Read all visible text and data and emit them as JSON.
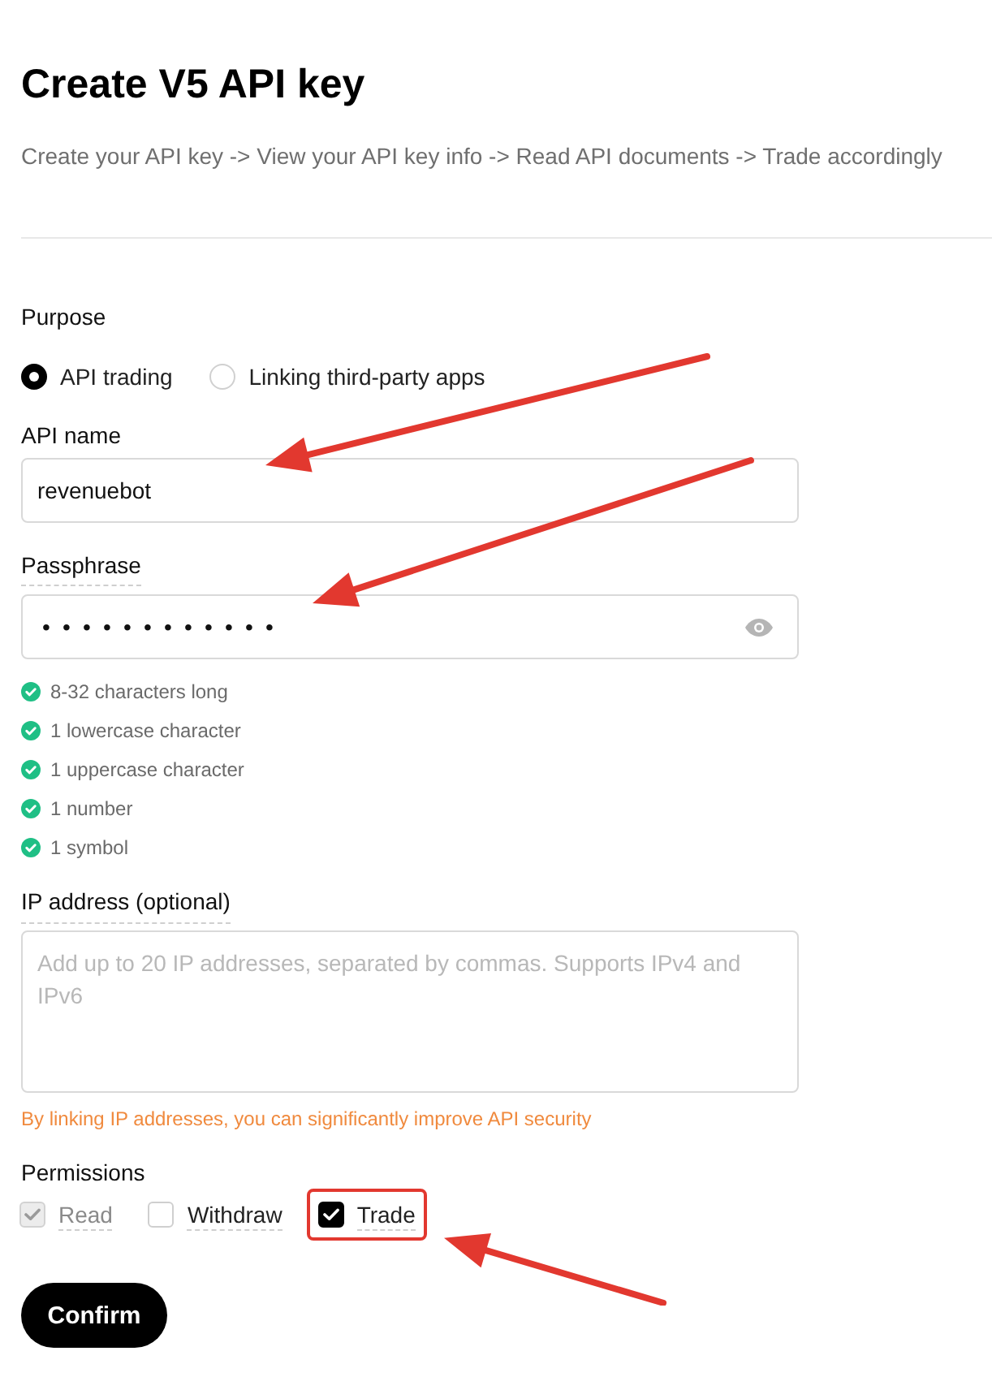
{
  "title": "Create V5 API key",
  "subtitle": "Create your API key -> View your API key info -> Read API documents -> Trade accordingly",
  "purpose": {
    "label": "Purpose",
    "options": [
      {
        "label": "API trading",
        "selected": true
      },
      {
        "label": "Linking third-party apps",
        "selected": false
      }
    ]
  },
  "api_name": {
    "label": "API name",
    "value": "revenuebot",
    "annotated": true
  },
  "passphrase": {
    "label": "Passphrase",
    "value": "••••••••••••",
    "annotated": true,
    "requirements": [
      {
        "text": "8-32 characters long",
        "met": true
      },
      {
        "text": "1 lowercase character",
        "met": true
      },
      {
        "text": "1 uppercase character",
        "met": true
      },
      {
        "text": "1 number",
        "met": true
      },
      {
        "text": "1 symbol",
        "met": true
      }
    ]
  },
  "ip_address": {
    "label": "IP address (optional)",
    "placeholder": "Add up to 20 IP addresses, separated by commas. Supports IPv4 and IPv6",
    "hint": "By linking IP addresses, you can significantly improve API security"
  },
  "permissions": {
    "label": "Permissions",
    "items": [
      {
        "label": "Read",
        "checked": true,
        "disabled": true,
        "highlighted": false,
        "annotated": false
      },
      {
        "label": "Withdraw",
        "checked": false,
        "disabled": false,
        "highlighted": false,
        "annotated": false
      },
      {
        "label": "Trade",
        "checked": true,
        "disabled": false,
        "highlighted": true,
        "annotated": true
      }
    ]
  },
  "confirm_button": "Confirm"
}
